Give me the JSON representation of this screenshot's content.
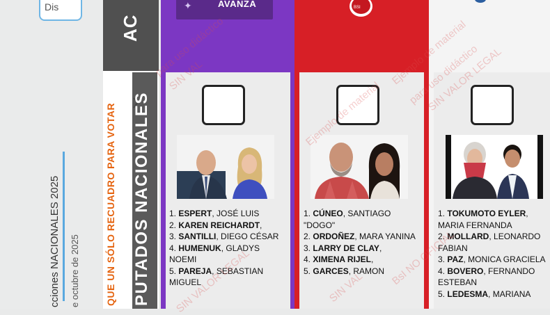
{
  "left_panel": {
    "disc_label": "Dis",
    "election_title": "cciones NACIONALES 2025",
    "date_label": "e octubre de 2025"
  },
  "header": {
    "ac_label": "AC",
    "instruction": "QUE UN SÓLO RECUADRO PARA VOTAR",
    "category": "PUTADOS NACIONALES"
  },
  "parties": [
    {
      "logo_text": "AVANZA",
      "color": "#7c37c3",
      "candidates": [
        {
          "num": "1.",
          "surname": "ESPERT",
          "name": ", JOSÉ LUIS"
        },
        {
          "num": "2.",
          "surname": "KAREN REICHARDT",
          "name": ","
        },
        {
          "num": "3.",
          "surname": "SANTILLI",
          "name": ", DIEGO CÉSAR"
        },
        {
          "num": "4.",
          "surname": "HUMENUK",
          "name": ", GLADYS NOEMI"
        },
        {
          "num": "5.",
          "surname": "PAREJA",
          "name": ", SEBASTIAN MIGUEL"
        }
      ]
    },
    {
      "logo_text": "BSI",
      "color": "#d71f26",
      "candidates": [
        {
          "num": "1.",
          "surname": "CÚNEO",
          "name": ", SANTIAGO \"DOGO\""
        },
        {
          "num": "2.",
          "surname": "ORDOÑEZ",
          "name": ", MARA YANINA"
        },
        {
          "num": "3.",
          "surname": "LARRY DE CLAY",
          "name": ","
        },
        {
          "num": "4.",
          "surname": "XIMENA RIJEL",
          "name": ","
        },
        {
          "num": "5.",
          "surname": "GARCES",
          "name": ", RAMON"
        }
      ]
    },
    {
      "logo_text": "",
      "color": "#f4f4f4",
      "candidates": [
        {
          "num": "1.",
          "surname": "TOKUMOTO EYLER",
          "name": ", MARIA FERNANDA"
        },
        {
          "num": "2.",
          "surname": "MOLLARD",
          "name": ", LEONARDO FABIAN"
        },
        {
          "num": "3.",
          "surname": "PAZ",
          "name": ", MONICA GRACIELA"
        },
        {
          "num": "4.",
          "surname": "BOVERO",
          "name": ", FERNANDO ESTEBAN"
        },
        {
          "num": "5.",
          "surname": "LEDESMA",
          "name": ", MARIANA"
        }
      ]
    }
  ],
  "watermarks": {
    "sin_valor": "SIN VALOR LEGAL",
    "ejemplo": "Ejemplo de material",
    "didactico": "para uso didáctico",
    "bsi": "BsI NO OFICIAL",
    "sin_valor_short": "SIN VAL"
  }
}
